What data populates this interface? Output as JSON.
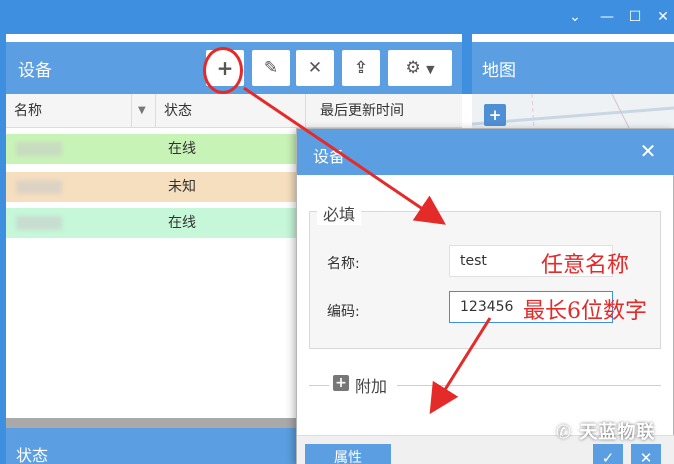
{
  "device_panel": {
    "title": "设备",
    "columns": [
      "名称",
      "状态",
      "最后更新时间"
    ],
    "rows": [
      {
        "name": "",
        "status": "在线",
        "bg": "#c8f3b7"
      },
      {
        "name": "",
        "status": "未知",
        "bg": "#f6dfbf"
      },
      {
        "name": "",
        "status": "在线",
        "bg": "#c6f7d9"
      }
    ]
  },
  "toolbar": {
    "add_icon": "plus-icon",
    "edit_icon": "pencil-icon",
    "delete_icon": "close-icon",
    "upload_icon": "upload-icon",
    "settings_icon": "gear-icon"
  },
  "map_panel": {
    "title": "地图"
  },
  "status_panel": {
    "title": "状态"
  },
  "dialog": {
    "title": "设备",
    "required_legend": "必填",
    "name_label": "名称:",
    "name_value": "test",
    "code_label": "编码:",
    "code_value": "123456",
    "extra_legend": "附加",
    "props_button": "属性"
  },
  "annotations": {
    "name_hint": "任意名称",
    "code_hint": "最长6位数字"
  },
  "watermark": "天蓝物联",
  "colors": {
    "accent": "#5b9ee1",
    "titlebar": "#3e8fe0",
    "annotation": "#e52a2a"
  }
}
